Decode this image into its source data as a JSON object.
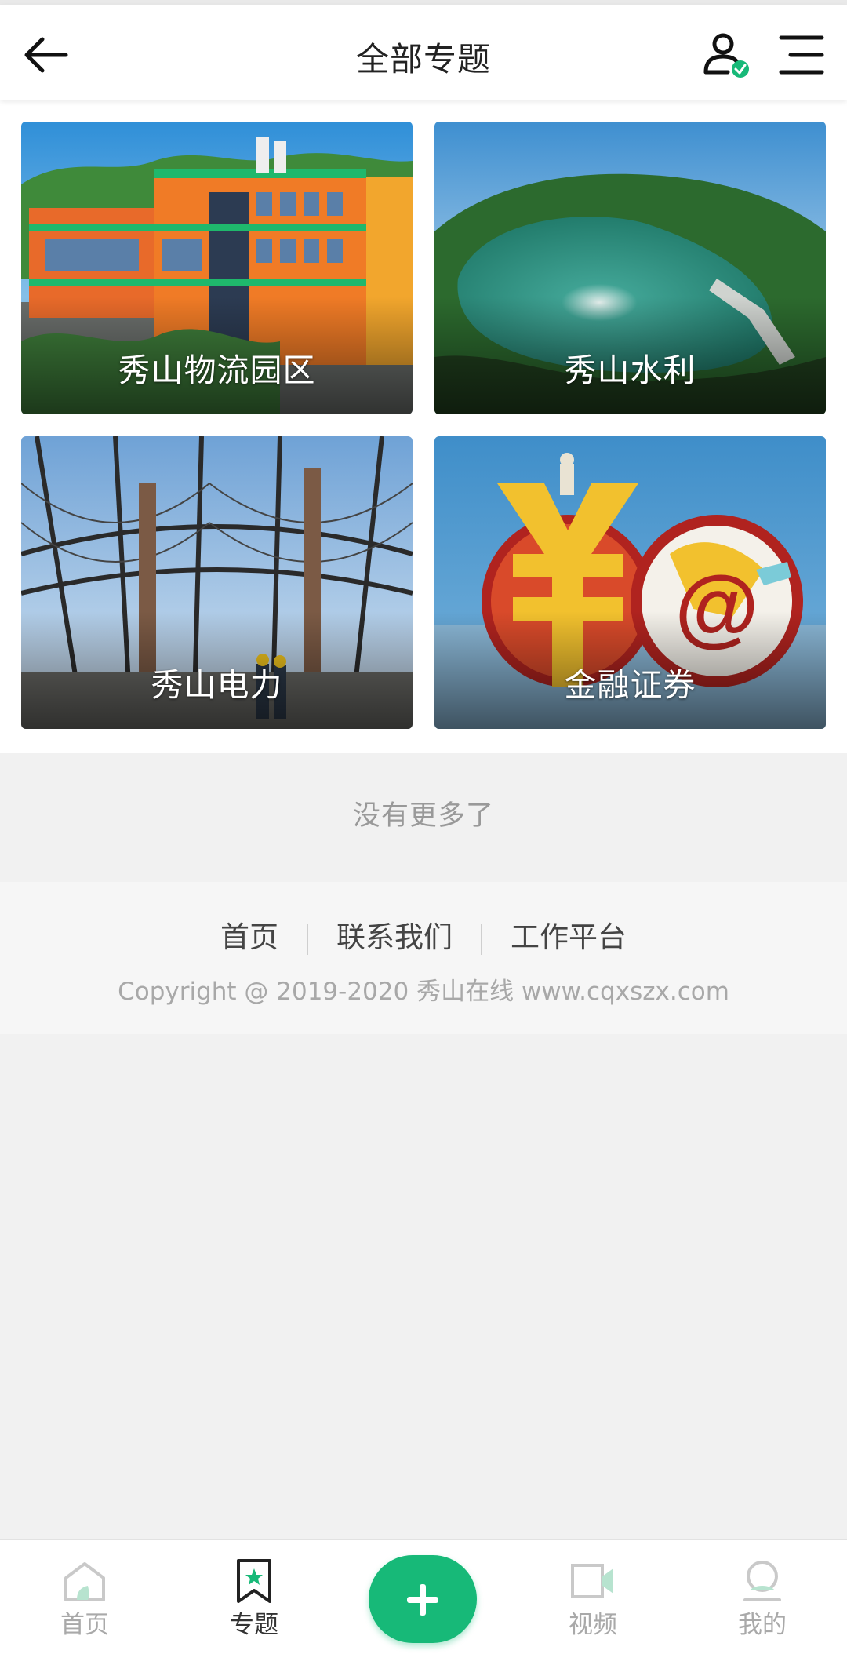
{
  "header": {
    "title": "全部专题"
  },
  "topics": [
    {
      "label": "秀山物流园区"
    },
    {
      "label": "秀山水利"
    },
    {
      "label": "秀山电力"
    },
    {
      "label": "金融证券"
    }
  ],
  "no_more_text": "没有更多了",
  "footer": {
    "links": [
      "首页",
      "联系我们",
      "工作平台"
    ],
    "copyright": "Copyright @ 2019-2020 秀山在线 www.cqxszx.com"
  },
  "tabbar": {
    "items": [
      {
        "label": "首页",
        "icon": "home-icon"
      },
      {
        "label": "专题",
        "icon": "bookmark-star-icon",
        "active": true
      },
      {
        "label": "视频",
        "icon": "video-icon"
      },
      {
        "label": "我的",
        "icon": "profile-icon"
      }
    ],
    "plus_icon": "plus-icon"
  },
  "colors": {
    "accent": "#17b978",
    "background": "#f1f1f1"
  }
}
